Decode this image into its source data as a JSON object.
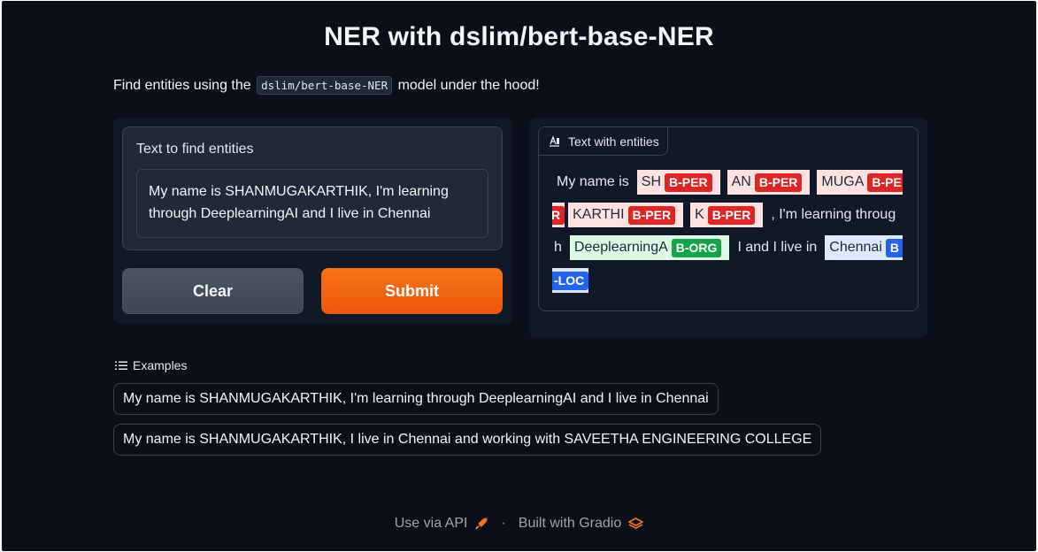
{
  "page": {
    "title": "NER with dslim/bert-base-NER",
    "description_prefix": "Find entities using the",
    "description_code": "dslim/bert-base-NER",
    "description_suffix": "model under the hood!"
  },
  "input": {
    "label": "Text to find entities",
    "value": "My name is SHANMUGAKARTHIK, I'm learning through DeeplearningAI and I live in Chennai"
  },
  "buttons": {
    "clear": "Clear",
    "submit": "Submit"
  },
  "output": {
    "tab_label": "Text with entities",
    "tab_icon": "highlight-text-icon",
    "lines": [
      [
        {
          "text": "My name is",
          "kind": "plain"
        },
        {
          "text": "SH",
          "kind": "entity",
          "tag": "B-PER",
          "type": "per"
        },
        {
          "text": "AN",
          "kind": "entity",
          "tag": "B-PER",
          "type": "per"
        },
        {
          "text": "MUGA",
          "kind": "entity",
          "tag": "B-PE",
          "type": "per"
        }
      ],
      [
        {
          "text": "",
          "kind": "tag-only",
          "tag": "R",
          "type": "per"
        },
        {
          "text": "KARTHI",
          "kind": "entity",
          "tag": "B-PER",
          "type": "per"
        },
        {
          "text": "K",
          "kind": "entity",
          "tag": "B-PER",
          "type": "per"
        },
        {
          "text": ", I'm learning throug",
          "kind": "plain"
        }
      ],
      [
        {
          "text": "h",
          "kind": "plain"
        },
        {
          "text": "DeeplearningA",
          "kind": "entity",
          "tag": "B-ORG",
          "type": "org"
        },
        {
          "text": "I and I live in",
          "kind": "plain"
        },
        {
          "text": "Chennai",
          "kind": "entity",
          "tag": "B",
          "type": "loc"
        }
      ],
      [
        {
          "text": "",
          "kind": "tag-only",
          "tag": "-LOC",
          "type": "loc"
        }
      ]
    ]
  },
  "examples": {
    "label": "Examples",
    "items": [
      "My name is SHANMUGAKARTHIK, I'm learning through DeeplearningAI and I live in Chennai",
      "My name is SHANMUGAKARTHIK, I live in Chennai and working with SAVEETHA ENGINEERING COLLEGE"
    ]
  },
  "footer": {
    "api": "Use via API",
    "separator": "·",
    "built": "Built with Gradio"
  },
  "colors": {
    "background": "#0b0f19",
    "panel": "#111827",
    "accent": "#f97316",
    "per_bg": "#fee2e2",
    "per_tag": "#dc2626",
    "org_bg": "#dcfce7",
    "org_tag": "#16a34a",
    "loc_bg": "#dbeafe",
    "loc_tag": "#2563eb"
  }
}
